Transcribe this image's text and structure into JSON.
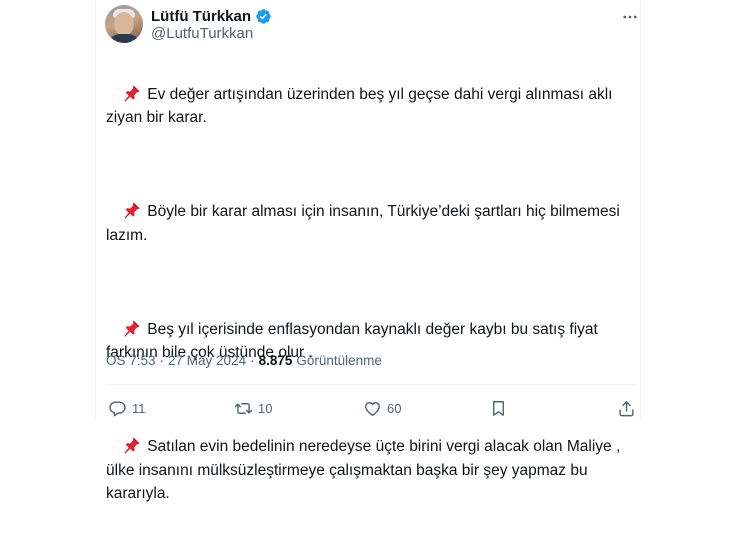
{
  "author": {
    "display_name": "Lütfü Türkkan",
    "handle": "@LutfuTurkkan",
    "verified": true
  },
  "icons": {
    "verified": "verified-badge-icon",
    "more": "more-options-icon",
    "pin": "pushpin-icon",
    "reply": "reply-icon",
    "retweet": "retweet-icon",
    "like": "like-icon",
    "bookmark": "bookmark-icon",
    "share": "share-icon"
  },
  "tweet": {
    "paragraphs": [
      "Ev değer artışından üzerinden beş yıl geçse dahi vergi alınması aklı\nziyan bir karar.",
      "Böyle bir karar alması için insanın, Türkiye’deki şartları hiç bilmemesi\nlazım.",
      "Beş yıl içerisinde enflasyondan kaynaklı değer kaybı bu satış fiyat\nfarkının bile çok üstünde olur .",
      "Satılan evin bedelinin neredeyse üçte birini vergi alacak olan Maliye ,\nülke insanını mülksüzleştirmeye çalışmaktan başka bir şey yapmaz bu\nkararıyla."
    ]
  },
  "meta": {
    "time": "ÖS 7:53",
    "separator": "·",
    "date": "27 May 2024",
    "views_count": "8.875",
    "views_label": "Görüntülenme"
  },
  "actions": {
    "replies": "11",
    "retweets": "10",
    "likes": "60"
  },
  "colors": {
    "text": "#0f1419",
    "secondary": "#536471",
    "verified": "#1d9bf0",
    "pin": "#e0242f",
    "divider": "#eff3f4"
  }
}
